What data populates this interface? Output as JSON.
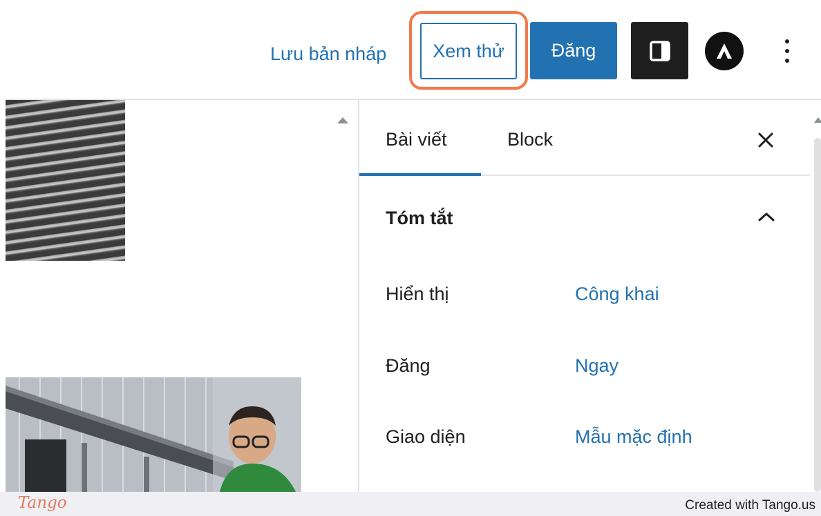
{
  "toolbar": {
    "save_draft_label": "Lưu bản nháp",
    "preview_label": "Xem thử",
    "publish_label": "Đăng",
    "sidebar_toggle_icon": "sidebar-toggle-icon",
    "plugin_icon": "astra-icon",
    "options_icon": "vertical-ellipsis-icon",
    "accent_color": "#2271b1",
    "highlight_color": "#f27a4a"
  },
  "sidebar": {
    "tabs": [
      {
        "label": "Bài viết",
        "active": true
      },
      {
        "label": "Block",
        "active": false
      }
    ],
    "close_icon": "close-icon",
    "summary_panel": {
      "title": "Tóm tắt",
      "expanded": true,
      "rows": [
        {
          "label": "Hiển thị",
          "value": "Công khai"
        },
        {
          "label": "Đăng",
          "value": "Ngay"
        },
        {
          "label": "Giao diện",
          "value": "Mẫu mặc định"
        }
      ]
    }
  },
  "footer": {
    "logo": "Tango",
    "credit": "Created with Tango.us"
  }
}
